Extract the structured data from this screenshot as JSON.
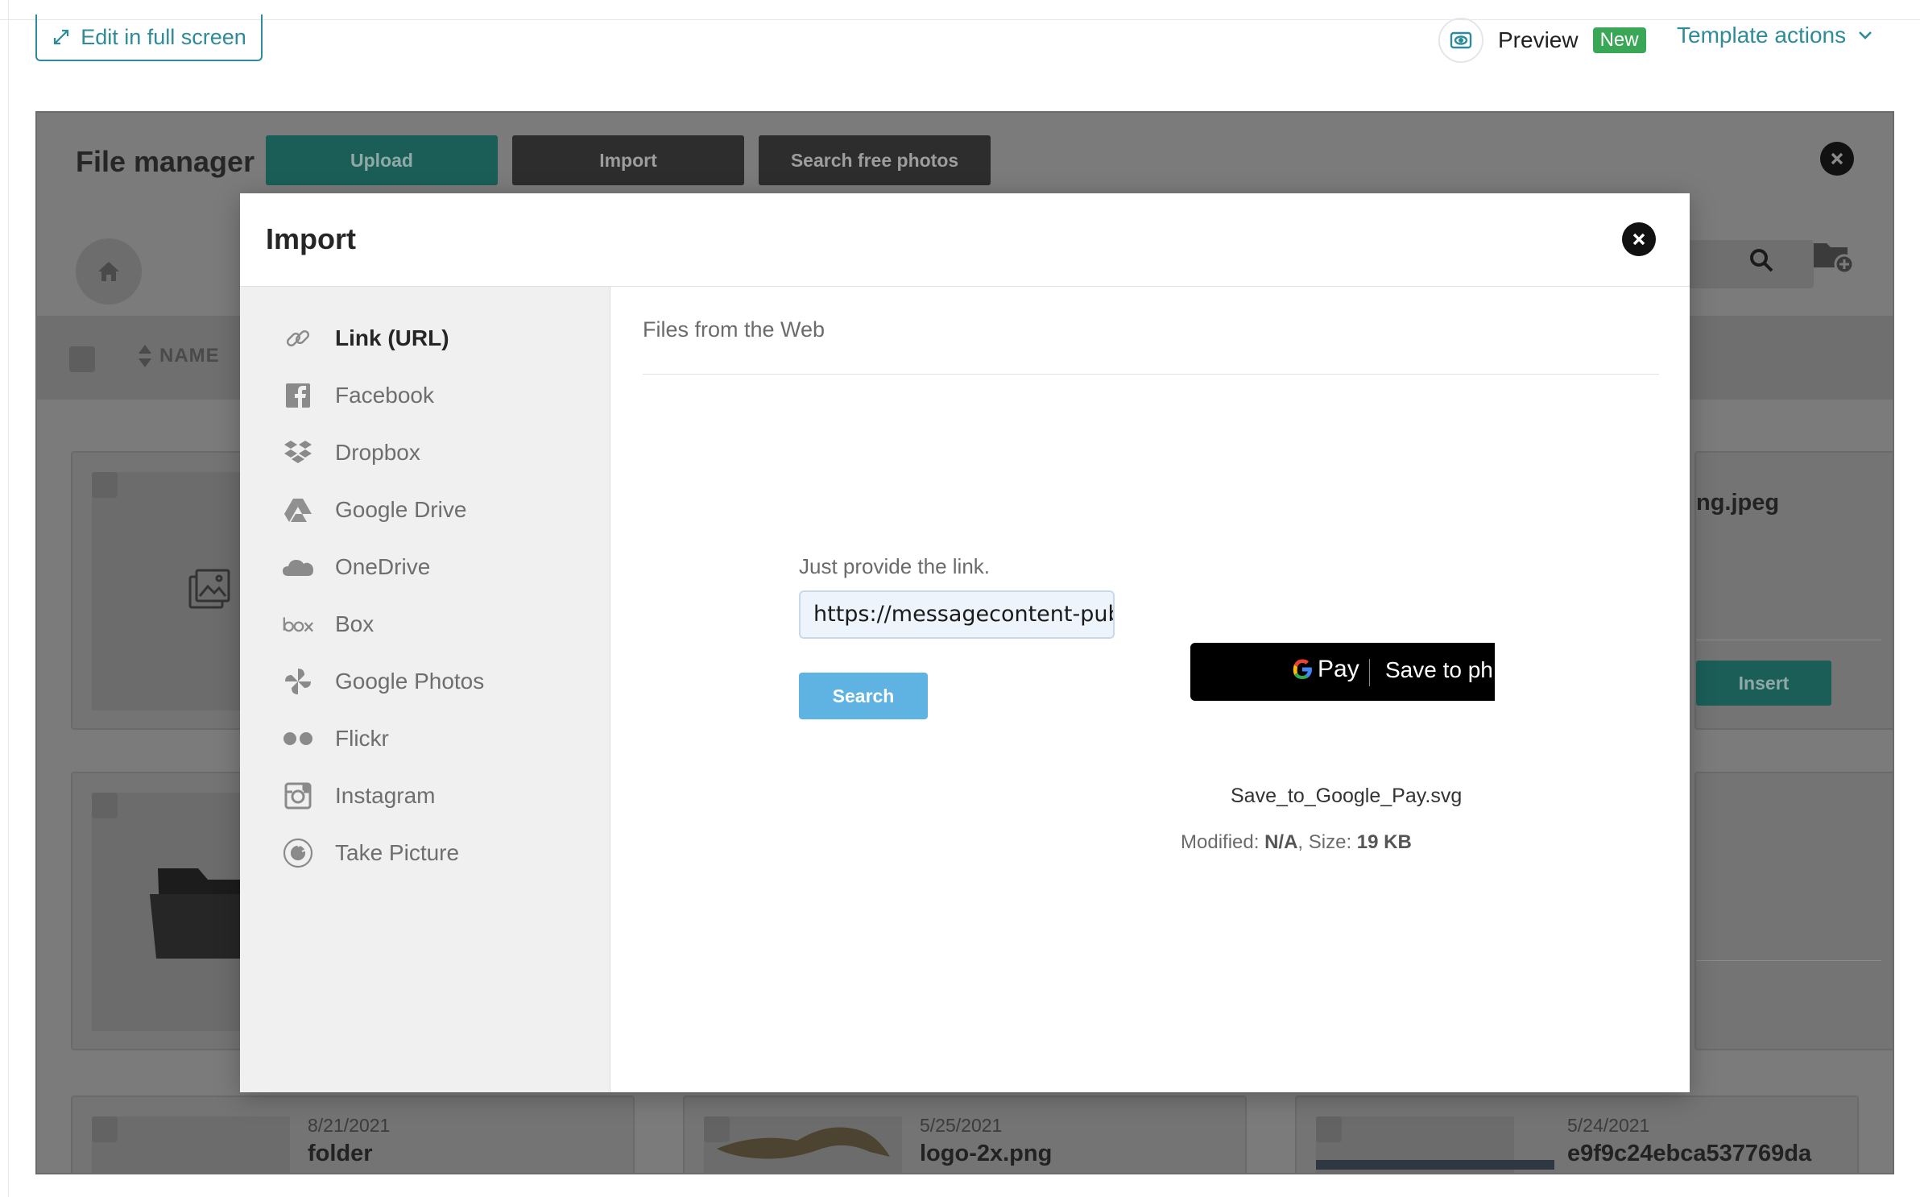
{
  "editor": {
    "edit_full_screen": "Edit in full screen",
    "preview_label": "Preview",
    "new_badge": "New",
    "template_actions": "Template actions"
  },
  "file_manager": {
    "title": "File manager",
    "upload": "Upload",
    "import": "Import",
    "search_free_photos": "Search free photos",
    "sort_column": "NAME",
    "insert": "Insert",
    "partial_card_name": "ng.jpeg",
    "cards": [
      {
        "date": "8/21/2021",
        "name": "folder"
      },
      {
        "date": "5/25/2021",
        "name": "logo-2x.png"
      },
      {
        "date": "5/24/2021",
        "name": "e9f9c24ebca537769da"
      }
    ]
  },
  "import_modal": {
    "title": "Import",
    "sources": [
      {
        "label": "Link (URL)",
        "icon": "link-icon",
        "active": true
      },
      {
        "label": "Facebook",
        "icon": "facebook-icon",
        "active": false
      },
      {
        "label": "Dropbox",
        "icon": "dropbox-icon",
        "active": false
      },
      {
        "label": "Google Drive",
        "icon": "google-drive-icon",
        "active": false
      },
      {
        "label": "OneDrive",
        "icon": "onedrive-icon",
        "active": false
      },
      {
        "label": "Box",
        "icon": "box-icon",
        "active": false
      },
      {
        "label": "Google Photos",
        "icon": "google-photos-icon",
        "active": false
      },
      {
        "label": "Flickr",
        "icon": "flickr-icon",
        "active": false
      },
      {
        "label": "Instagram",
        "icon": "instagram-icon",
        "active": false
      },
      {
        "label": "Take Picture",
        "icon": "camera-icon",
        "active": false
      }
    ],
    "content_title": "Files from the Web",
    "link_prompt": "Just provide the link.",
    "link_value": "https://messagecontent-publ",
    "search_button": "Search",
    "preview": {
      "gpay_pay": "Pay",
      "gpay_save": "Save to ph",
      "file_name": "Save_to_Google_Pay.svg",
      "modified_label": "Modified:",
      "modified_value": "N/A",
      "size_label": "Size:",
      "size_value": "19 KB"
    }
  },
  "colors": {
    "accent_teal": "#2e8b9a",
    "new_badge": "#3aa757",
    "search_button": "#5fb3e3",
    "overlay_gray": "#7b7b7b"
  }
}
